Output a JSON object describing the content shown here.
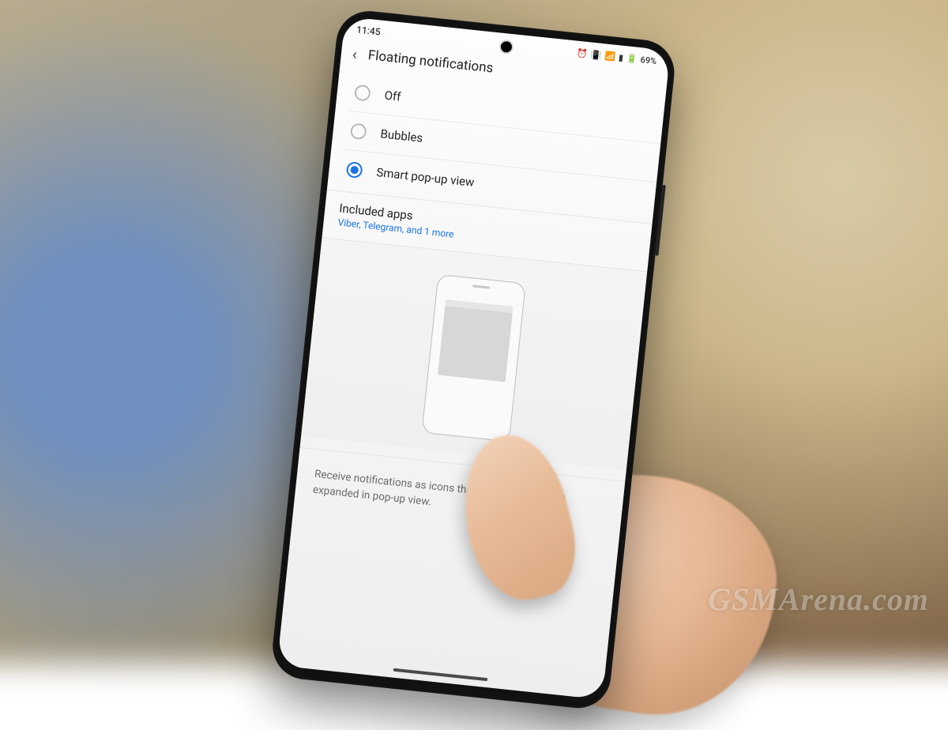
{
  "watermark": "GSMArena.com",
  "status": {
    "time": "11:45",
    "battery": "69%",
    "icons": {
      "alarm": "⏰",
      "vibrate": "📳",
      "wifi": "📶",
      "signal": "▮",
      "battery_glyph": "🔋"
    }
  },
  "header": {
    "title": "Floating notifications"
  },
  "options": [
    {
      "label": "Off",
      "selected": false
    },
    {
      "label": "Bubbles",
      "selected": false
    },
    {
      "label": "Smart pop-up view",
      "selected": true
    }
  ],
  "included_apps": {
    "title": "Included apps",
    "summary": "Viber, Telegram, and 1 more"
  },
  "description": "Receive notifications as icons that can be tapped and expanded in pop-up view."
}
